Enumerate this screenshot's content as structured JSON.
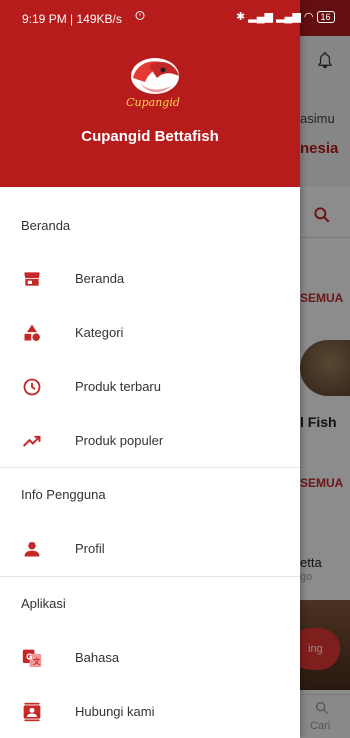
{
  "status_bar": {
    "time_speed": "9:19 PM | 149KB/s",
    "battery": "16"
  },
  "app": {
    "name": "Cupangid Bettafish",
    "logo_text": "Cupangid"
  },
  "background": {
    "welcome_text": "asimu",
    "brand_text": "nesia",
    "see_all_1": "SEMUA",
    "product_name": "l Fish",
    "see_all_2": "SEMUA",
    "product_name_2": "etta",
    "product_sub_2": "go",
    "fab_label": "ing",
    "nav_search_label": "Cari"
  },
  "menu": {
    "sections": [
      {
        "title": "Beranda",
        "items": [
          {
            "label": "Beranda",
            "icon": "store-icon"
          },
          {
            "label": "Kategori",
            "icon": "category-icon"
          },
          {
            "label": "Produk terbaru",
            "icon": "clock-icon"
          },
          {
            "label": "Produk populer",
            "icon": "trending-icon"
          }
        ]
      },
      {
        "title": "Info Pengguna",
        "items": [
          {
            "label": "Profil",
            "icon": "person-icon"
          }
        ]
      },
      {
        "title": "Aplikasi",
        "items": [
          {
            "label": "Bahasa",
            "icon": "translate-icon"
          },
          {
            "label": "Hubungi kami",
            "icon": "contact-icon"
          }
        ]
      }
    ]
  },
  "colors": {
    "primary": "#b71c1c",
    "icon": "#c62828"
  }
}
